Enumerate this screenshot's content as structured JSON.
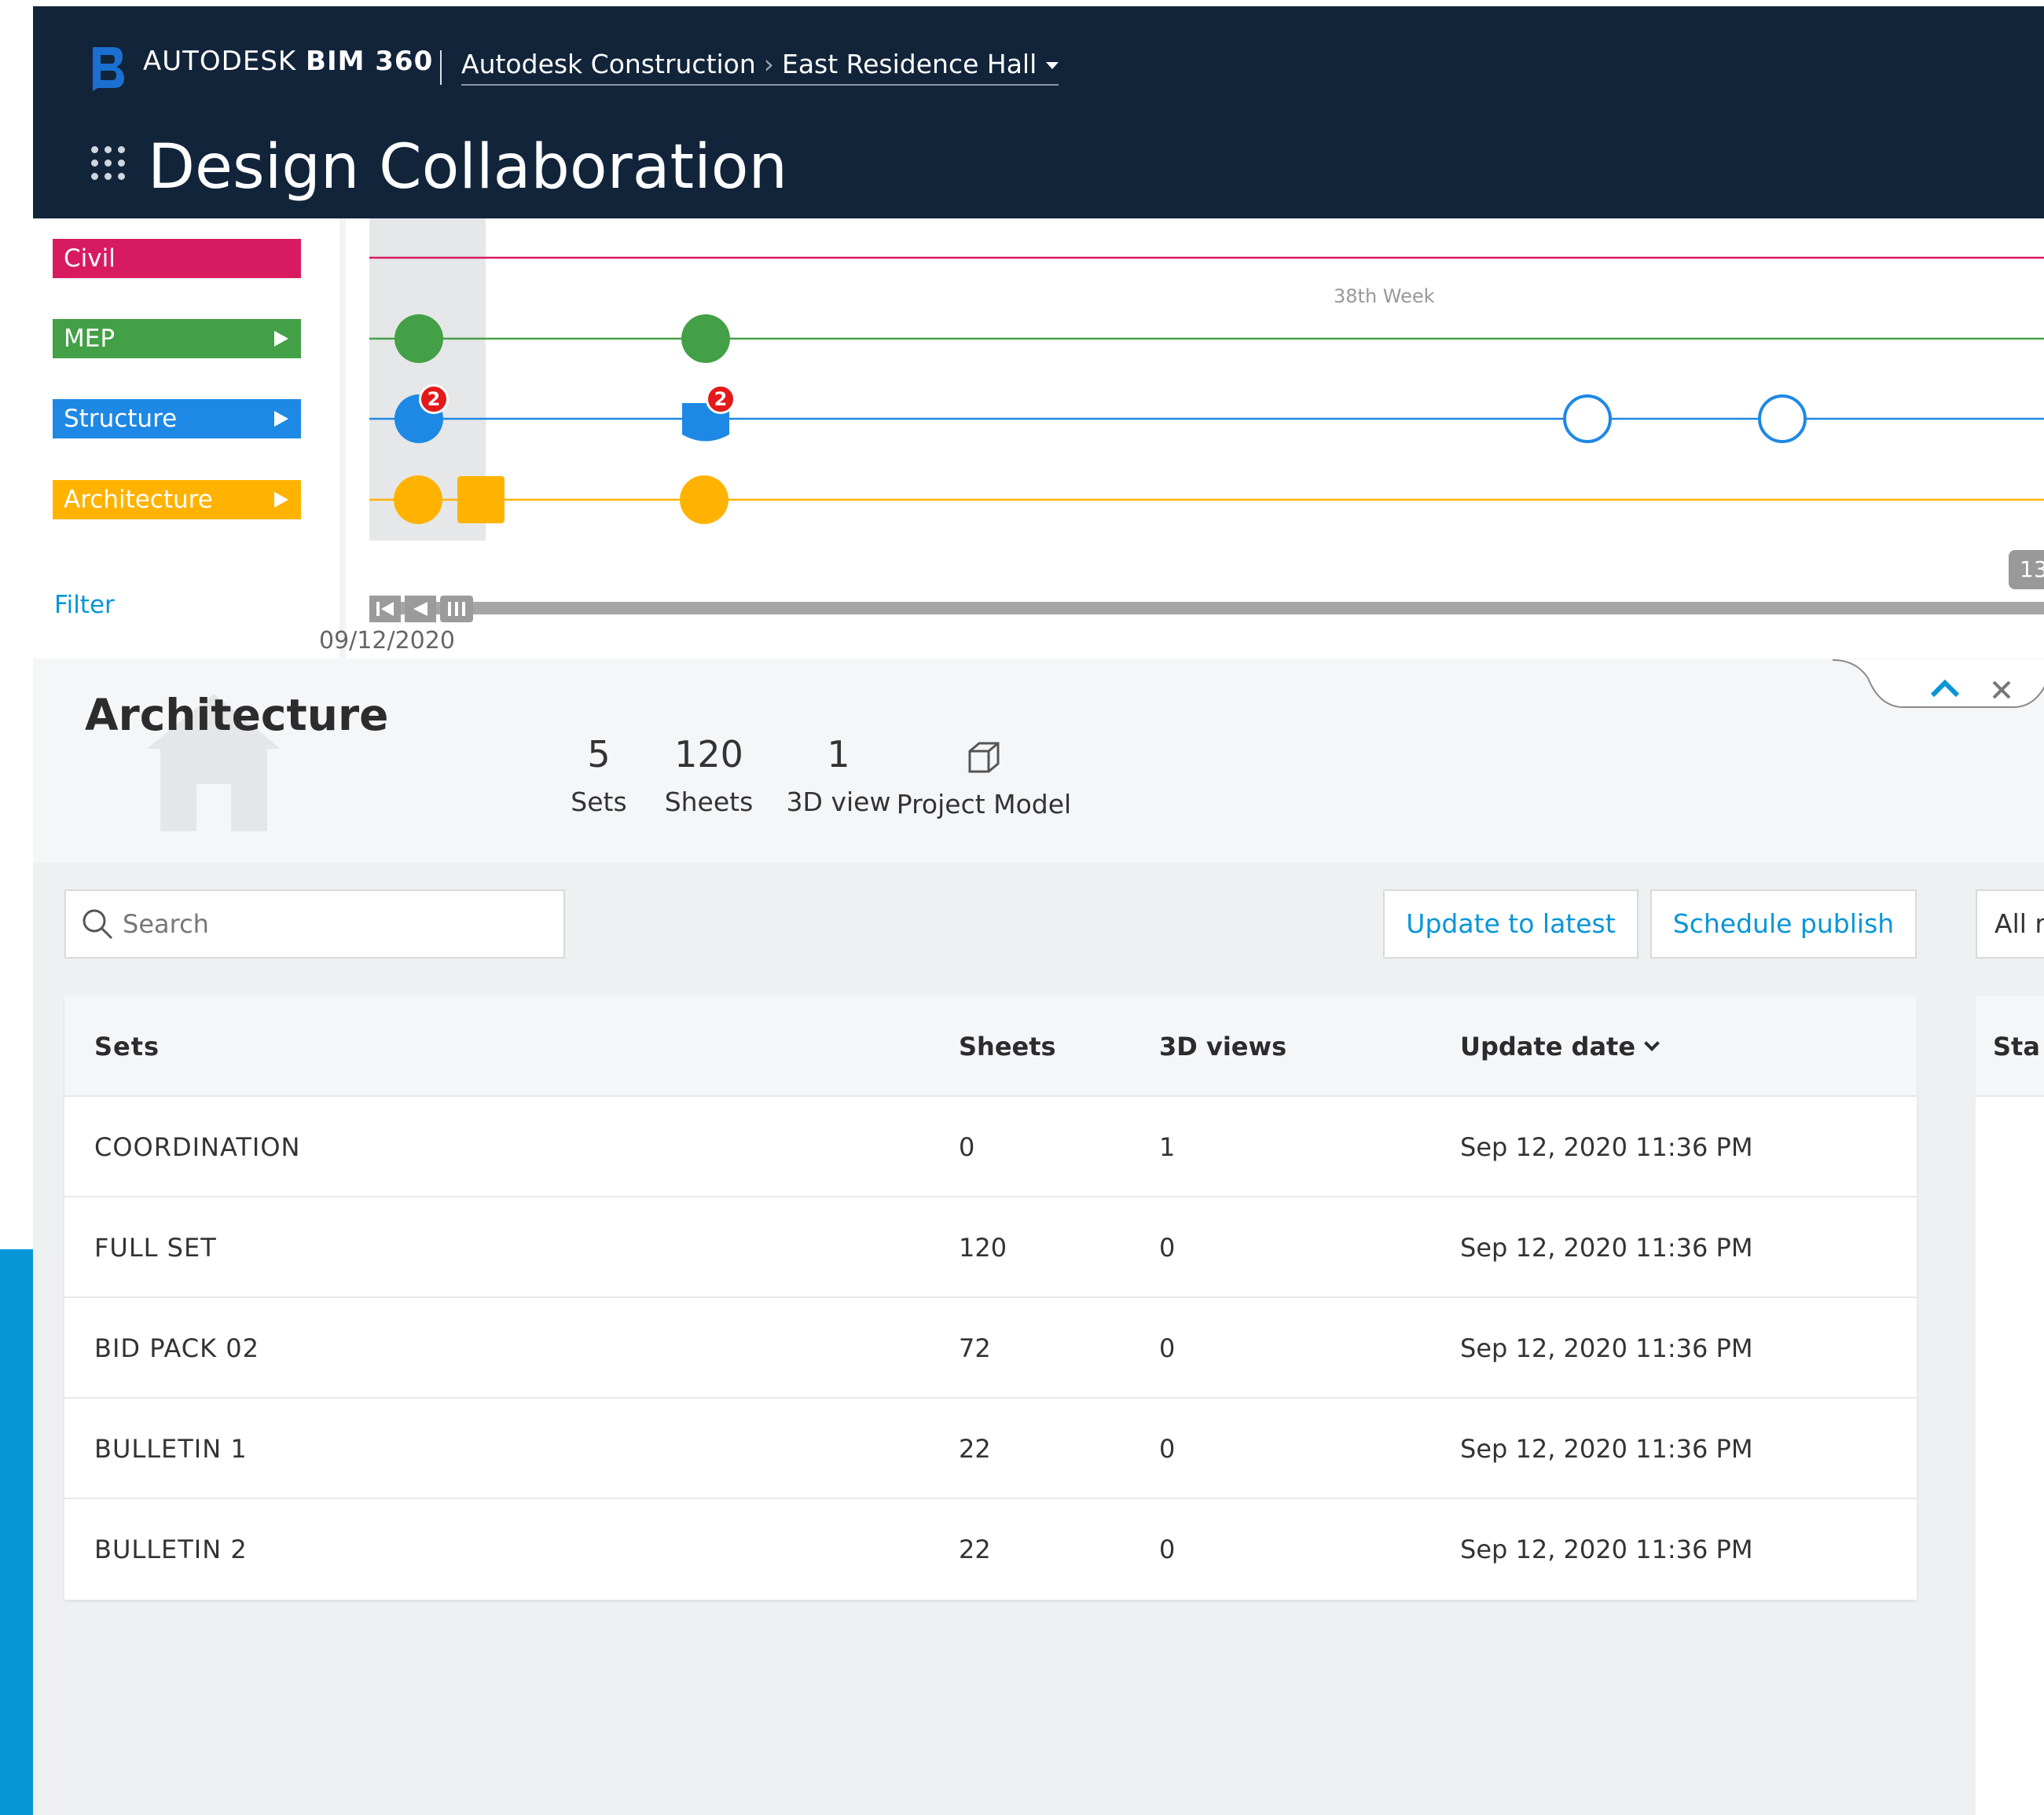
{
  "header": {
    "brand_light": "AUTODESK",
    "brand_bold": "BIM 360",
    "breadcrumb_company": "Autodesk Construction",
    "breadcrumb_project": "East Residence Hall",
    "title": "Design Collaboration",
    "colors": {
      "background": "#12243a",
      "logo": "#1a6fd1"
    }
  },
  "disciplines": [
    {
      "label": "Civil",
      "color": "#d81b60",
      "expandable": false
    },
    {
      "label": "MEP",
      "color": "#43a047",
      "expandable": true
    },
    {
      "label": "Structure",
      "color": "#1e88e5",
      "expandable": true
    },
    {
      "label": "Architecture",
      "color": "#ffb300",
      "expandable": true
    }
  ],
  "filter_label": "Filter",
  "timeline": {
    "week_label": "38th Week",
    "date_label": "09/12/2020",
    "count_badge": "13",
    "structure_badges": [
      "2",
      "2"
    ]
  },
  "details": {
    "title": "Architecture",
    "stats": [
      {
        "value": "5",
        "label": "Sets"
      },
      {
        "value": "120",
        "label": "Sheets"
      },
      {
        "value": "1",
        "label": "3D view"
      }
    ],
    "model_label": "Project Model"
  },
  "toolbar": {
    "search_placeholder": "Search",
    "update_button": "Update to latest",
    "schedule_button": "Schedule publish",
    "filter_dropdown": "All r"
  },
  "table": {
    "columns": [
      "Sets",
      "Sheets",
      "3D views",
      "Update date"
    ],
    "rows": [
      {
        "set": "COORDINATION",
        "sheets": "0",
        "views": "1",
        "date": "Sep 12, 2020 11:36 PM"
      },
      {
        "set": "FULL SET",
        "sheets": "120",
        "views": "0",
        "date": "Sep 12, 2020 11:36 PM"
      },
      {
        "set": "BID PACK 02",
        "sheets": "72",
        "views": "0",
        "date": "Sep 12, 2020 11:36 PM"
      },
      {
        "set": "BULLETIN 1",
        "sheets": "22",
        "views": "0",
        "date": "Sep 12, 2020 11:36 PM"
      },
      {
        "set": "BULLETIN 2",
        "sheets": "22",
        "views": "0",
        "date": "Sep 12, 2020 11:36 PM"
      }
    ]
  },
  "side_table": {
    "column": "Sta"
  }
}
